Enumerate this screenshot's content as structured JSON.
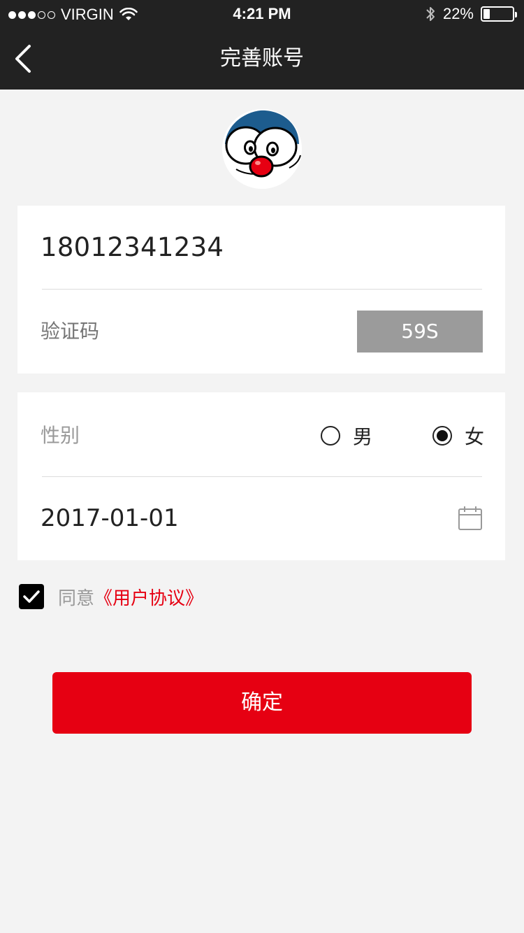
{
  "status_bar": {
    "carrier": "VIRGIN",
    "time": "4:21 PM",
    "battery_text": "22%",
    "battery_level": 0.22
  },
  "nav": {
    "title": "完善账号",
    "back_icon": "chevron-left-icon"
  },
  "form": {
    "phone": "18012341234",
    "code_placeholder": "验证码",
    "code_countdown": "59S",
    "gender_label": "性别",
    "gender_options": [
      "男",
      "女"
    ],
    "gender_selected": "女",
    "birthday": "2017-01-01"
  },
  "agreement": {
    "prefix": "同意",
    "link": "《用户协议》",
    "checked": true
  },
  "confirm_label": "确定",
  "colors": {
    "header_bg": "#222222",
    "page_bg": "#f3f3f3",
    "accent_red": "#e60012",
    "countdown_bg": "#9b9b9b"
  }
}
